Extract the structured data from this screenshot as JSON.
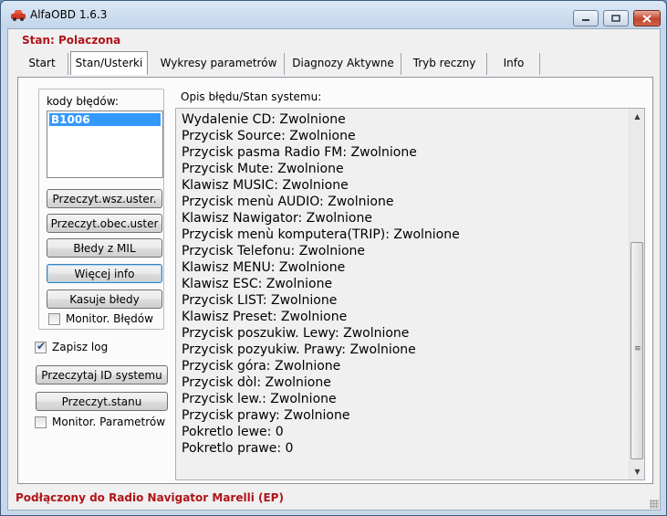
{
  "window": {
    "title": "AlfaOBD 1.6.3",
    "icon": "car-icon",
    "caption_buttons": [
      "minimize-icon",
      "maximize-icon",
      "close-icon"
    ]
  },
  "status_top": "Stan: Polaczona",
  "tabs": [
    {
      "label": "Start",
      "active": false
    },
    {
      "label": "Stan/Usterki",
      "active": true
    },
    {
      "label": "Wykresy parametrów",
      "active": false
    },
    {
      "label": "Diagnozy Aktywne",
      "active": false
    },
    {
      "label": "Tryb reczny",
      "active": false
    },
    {
      "label": "Info",
      "active": false
    }
  ],
  "errors": {
    "label": "kody błędów:",
    "items": [
      "B1006"
    ],
    "selected": "B1006"
  },
  "buttons": {
    "read_all": "Przeczyt.wsz.uster.",
    "read_current": "Przeczyt.obec.uster",
    "mil_errors": "Błedy z MIL",
    "more_info": "Więcej info",
    "clear_errors": "Kasuje błedy",
    "read_id": "Przeczytaj ID systemu",
    "read_state": "Przeczyt.stanu"
  },
  "checkboxes": {
    "monitor_errors": {
      "label": "Monitor. Błędów",
      "checked": false
    },
    "save_log": {
      "label": "Zapisz log",
      "checked": true
    },
    "monitor_params": {
      "label": "Monitor. Parametrów",
      "checked": false
    }
  },
  "description": {
    "label": "Opis błędu/Stan systemu:",
    "lines": [
      "Wydalenie CD: Zwolnione",
      "Przycisk Source: Zwolnione",
      "Przycisk pasma Radio FM: Zwolnione",
      "Przycisk Mute: Zwolnione",
      "Klawisz MUSIC: Zwolnione",
      "Przycisk menù AUDIO: Zwolnione",
      "Klawisz Nawigator: Zwolnione",
      "Przycisk menù komputera(TRIP): Zwolnione",
      "Przycisk Telefonu: Zwolnione",
      "Klawisz MENU: Zwolnione",
      "Klawisz ESC: Zwolnione",
      "Przycisk LIST: Zwolnione",
      "Klawisz Preset: Zwolnione",
      "Przycisk poszukiw. Lewy: Zwolnione",
      "Przycisk pozyukiw. Prawy: Zwolnione",
      "Przycisk góra: Zwolnione",
      "Przycisk dòl: Zwolnione",
      "Przycisk lew.: Zwolnione",
      "Przycisk prawy: Zwolnione",
      "Pokretlo lewe: 0",
      "Pokretlo prawe: 0"
    ]
  },
  "status_bottom": "Podłączony do Radio Navigator Marelli (EP)",
  "colors": {
    "status_text": "#b0141a",
    "selection": "#3399ff"
  }
}
